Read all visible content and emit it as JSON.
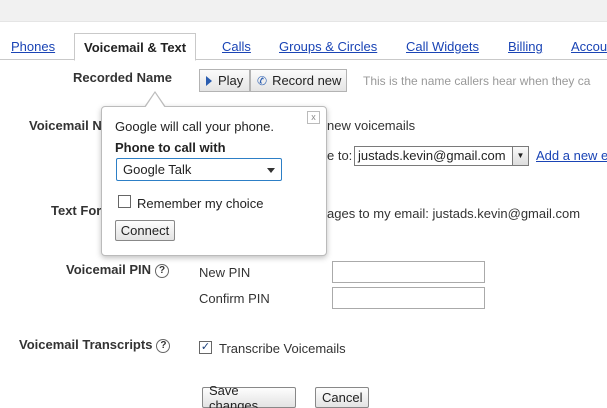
{
  "tabs": [
    {
      "label": "Phones"
    },
    {
      "label": "Voicemail & Text"
    },
    {
      "label": "Calls"
    },
    {
      "label": "Groups & Circles"
    },
    {
      "label": "Call Widgets"
    },
    {
      "label": "Billing"
    },
    {
      "label": "Accou"
    }
  ],
  "recorded_name": {
    "label": "Recorded Name",
    "play_label": "Play",
    "record_label": "Record new",
    "hint": "This is the name callers hear when they ca"
  },
  "voicemail_notifications": {
    "label": "Voicemail N",
    "text": "new voicemails",
    "send_to_label": "e to:",
    "email": "justads.kevin@gmail.com",
    "add_link": "Add a new e"
  },
  "text_forwarding": {
    "label": "Text For",
    "text": "ages to my email: justads.kevin@gmail.com"
  },
  "voicemail_pin": {
    "label": "Voicemail PIN",
    "new_pin_label": "New PIN",
    "confirm_pin_label": "Confirm PIN",
    "help": "?"
  },
  "voicemail_transcripts": {
    "label": "Voicemail Transcripts",
    "checkbox_label": "Transcribe Voicemails",
    "checked": true,
    "help": "?"
  },
  "actions": {
    "save_label": "Save changes",
    "cancel_label": "Cancel"
  },
  "popup": {
    "message": "Google will call your phone.",
    "phone_label": "Phone to call with",
    "phone_value": "Google Talk",
    "remember_label": "Remember my choice",
    "connect_label": "Connect",
    "close_symbol": "x"
  }
}
